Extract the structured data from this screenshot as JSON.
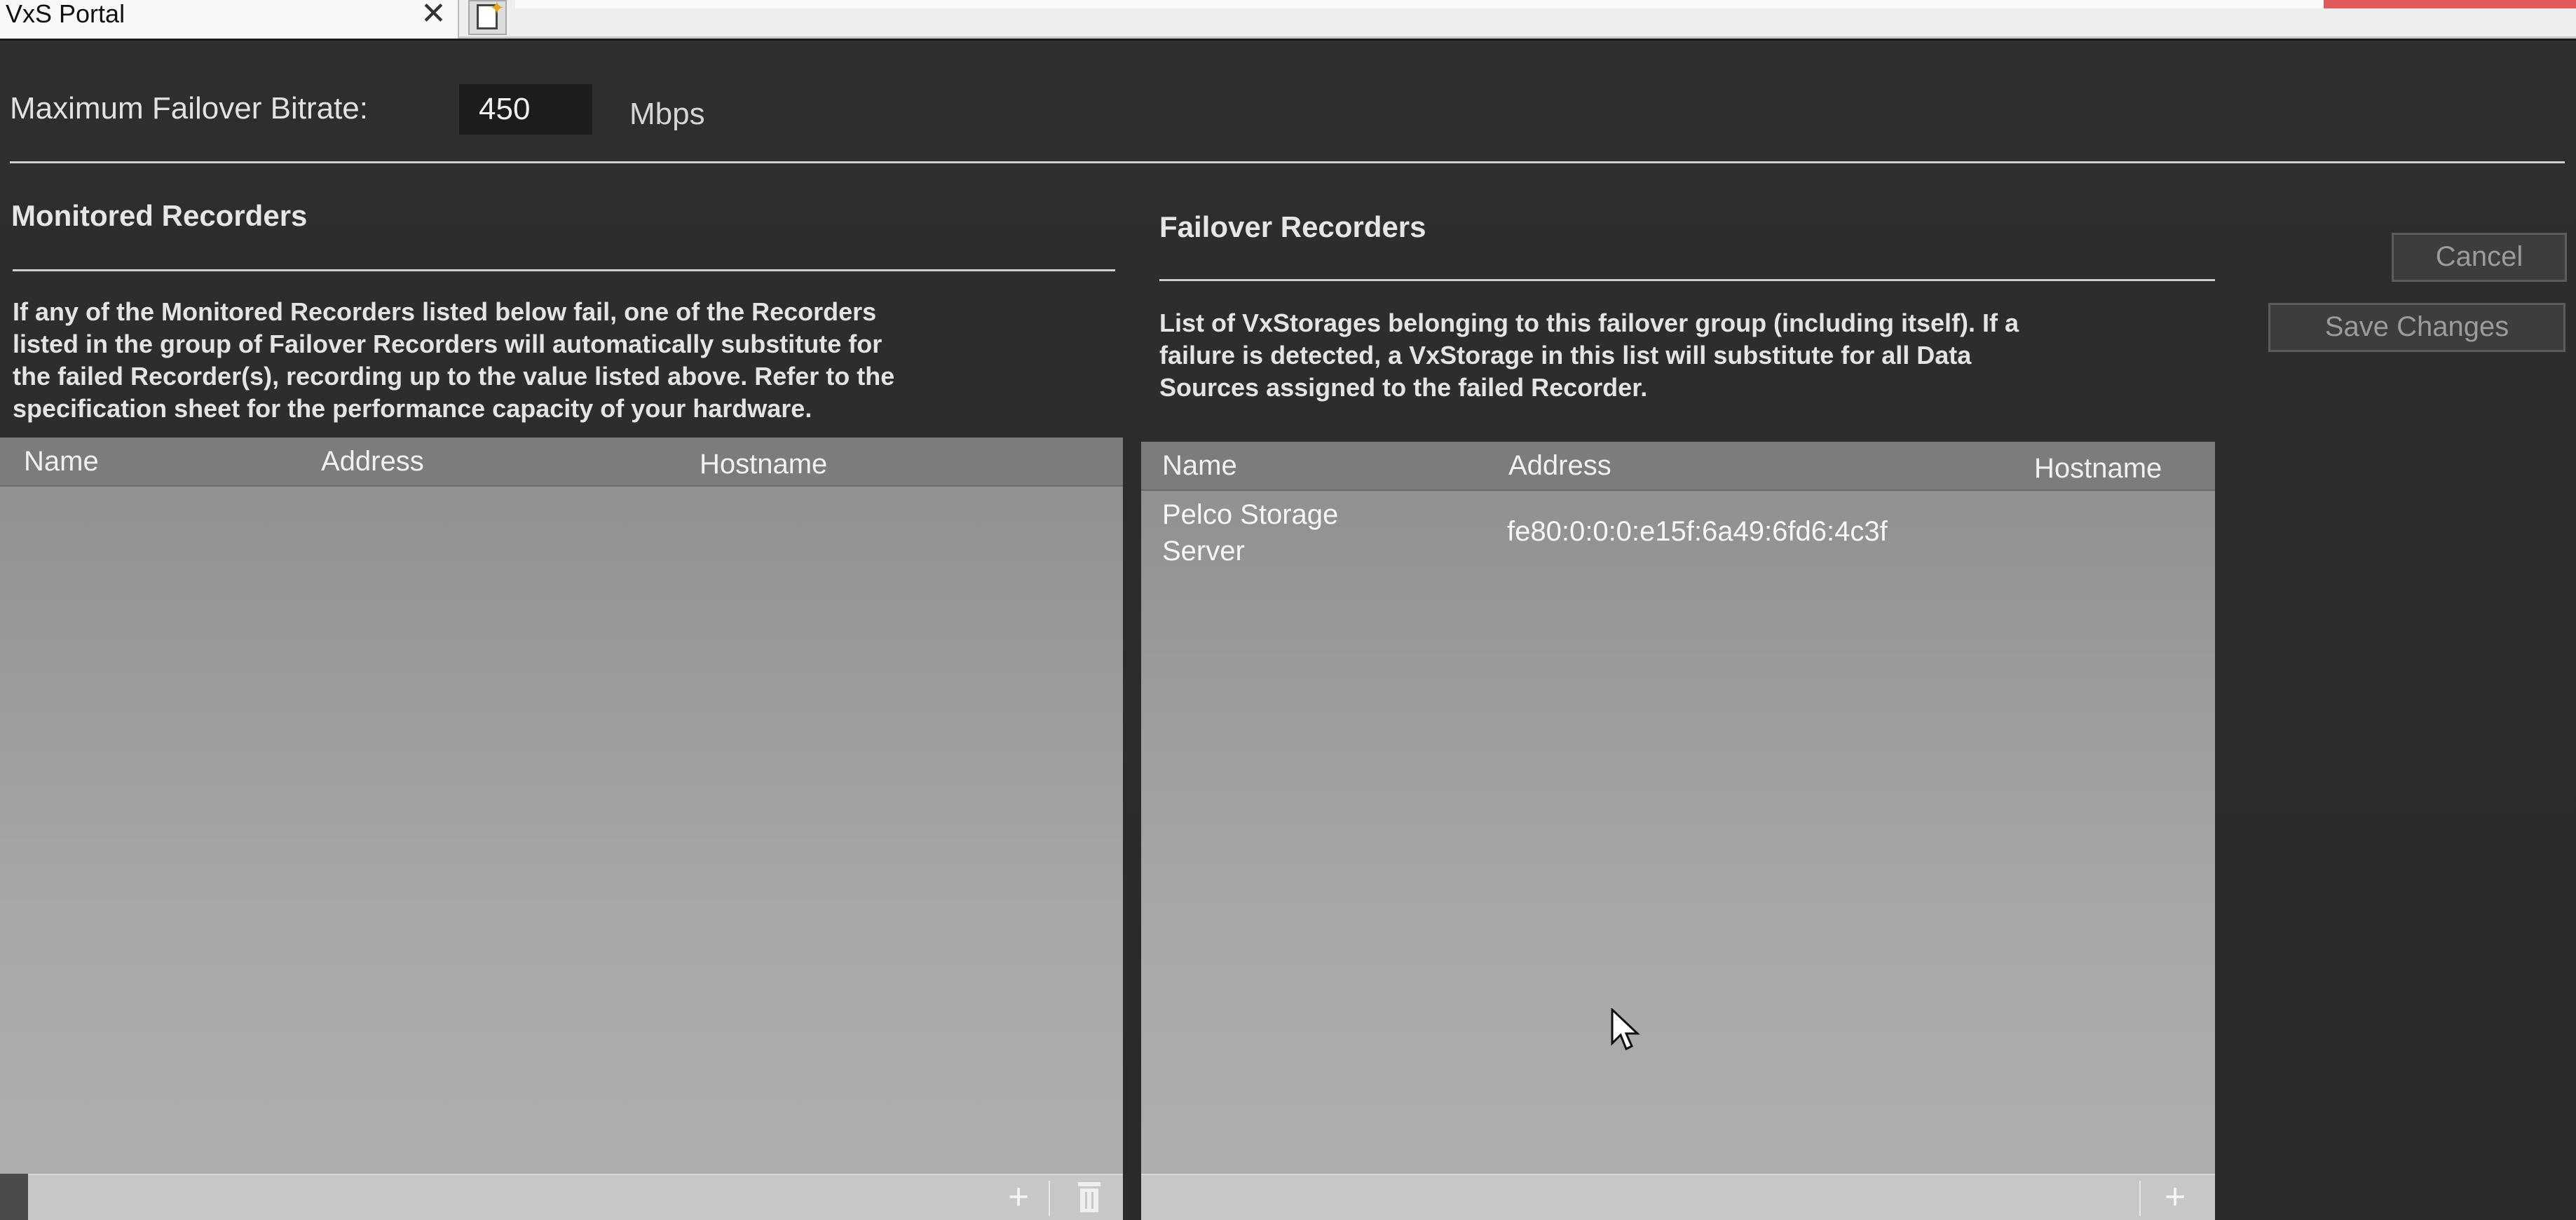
{
  "browser": {
    "tab_title": "VxS Portal",
    "close_glyph": "✕"
  },
  "settings": {
    "bitrate_label": "Maximum Failover Bitrate:",
    "bitrate_value": "450",
    "bitrate_unit": "Mbps"
  },
  "buttons": {
    "cancel": "Cancel",
    "save": "Save Changes"
  },
  "monitored": {
    "title": "Monitored Recorders",
    "description_lines": [
      "If any of the Monitored Recorders listed below fail, one of the Recorders",
      "listed in the group of Failover Recorders will automatically substitute for",
      "the failed Recorder(s), recording up to the value listed above. Refer to the",
      "specification sheet for the performance capacity of your hardware."
    ],
    "columns": [
      "Name",
      "Address",
      "Hostname"
    ],
    "rows": []
  },
  "failover": {
    "title": "Failover Recorders",
    "description_lines": [
      "List of VxStorages belonging to this failover group (including itself). If a",
      "failure is detected, a VxStorage in this list will substitute for all Data",
      "Sources assigned to the failed Recorder."
    ],
    "columns": [
      "Name",
      "Address",
      "Hostname"
    ],
    "rows": [
      {
        "name_lines": [
          "Pelco Storage",
          "Server"
        ],
        "address": "fe80:0:0:0:e15f:6a49:6fd6:4c3f",
        "hostname": ""
      }
    ]
  },
  "footer_icons": {
    "add": "+"
  },
  "icons": {
    "close": "close-icon",
    "new_tab": "new-tab-icon",
    "add": "add-icon",
    "delete": "trash-icon",
    "cursor": "mouse-cursor-icon"
  },
  "colors": {
    "background": "#2b2b2b",
    "table_header": "#7c7c7c",
    "table_body": "#a7a7a7",
    "button_text": "#9c9c9c"
  }
}
